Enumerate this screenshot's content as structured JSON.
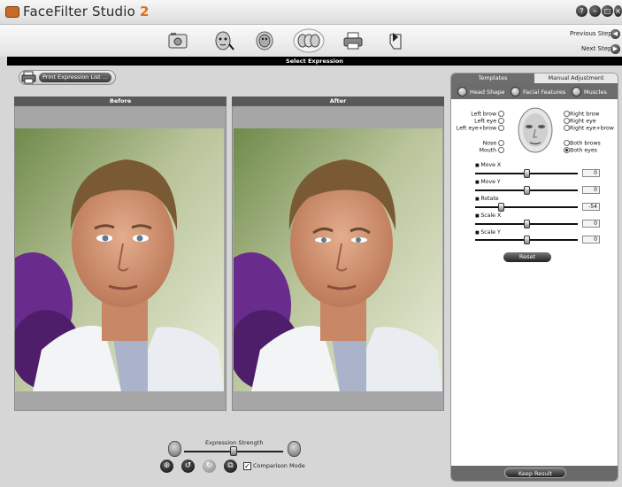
{
  "app": {
    "title": "FaceFilter Studio",
    "version": "2"
  },
  "window_controls": [
    "?",
    "–",
    "□",
    "×"
  ],
  "nav": {
    "previous": "Previous Step",
    "next": "Next Step"
  },
  "toolbar": {
    "tools": [
      "open-photo-icon",
      "face-features-icon",
      "face-mask-icon",
      "select-expression-icon",
      "print-icon",
      "export-icon"
    ]
  },
  "step_title": "Select Expression",
  "print_button": "Print Expression List ...",
  "before": {
    "label": "Before"
  },
  "after": {
    "label": "After"
  },
  "expression_strength": {
    "label": "Expression Strength",
    "level": 0.5
  },
  "comparison": {
    "label": "Comparison Mode",
    "checked": true
  },
  "right_panel": {
    "tabs": [
      "Templates",
      "Manual Adjustment"
    ],
    "subtabs": [
      "Head Shape",
      "Facial Features",
      "Muscles"
    ],
    "left_options": [
      "Left brow",
      "Left eye",
      "Left eye+brow",
      "Nose",
      "Mouth"
    ],
    "right_options": [
      "Right brow",
      "Right eye",
      "Right eye+brow",
      "Both brows",
      "Both eyes"
    ],
    "selected_option": "Both eyes",
    "sliders": [
      {
        "label": "Move X",
        "value": "0",
        "level": 0.5
      },
      {
        "label": "Move Y",
        "value": "0",
        "level": 0.5
      },
      {
        "label": "Rotate",
        "value": "-54",
        "level": 0.2
      },
      {
        "label": "Scale X",
        "value": "0",
        "level": 0.5
      },
      {
        "label": "Scale Y",
        "value": "0",
        "level": 0.5
      }
    ],
    "reset": "Reset",
    "keep_result": "Keep Result"
  }
}
